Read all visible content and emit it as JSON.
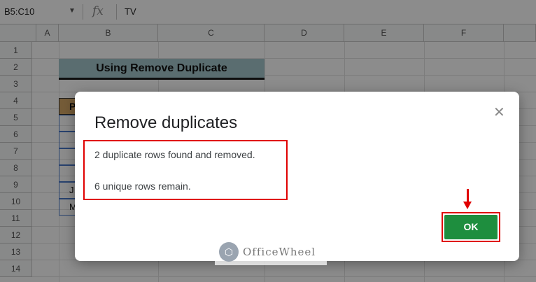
{
  "formula_bar": {
    "name_box": "B5:C10",
    "fx_label": "fx",
    "value": "TV"
  },
  "columns": [
    "A",
    "B",
    "C",
    "D",
    "E",
    "F"
  ],
  "rows": [
    "1",
    "2",
    "3",
    "4",
    "5",
    "6",
    "7",
    "8",
    "9",
    "10",
    "11",
    "12",
    "13",
    "14"
  ],
  "sheet": {
    "title": "Using Remove Duplicate",
    "header_partial": "P",
    "partial_cells": [
      "",
      "",
      "",
      "",
      "J",
      "M"
    ]
  },
  "dialog": {
    "title": "Remove duplicates",
    "close": "✕",
    "message_1": "2 duplicate rows found and removed.",
    "message_2": "6 unique rows remain.",
    "ok_label": "OK"
  },
  "watermark": {
    "logo": "⬡",
    "text": "OfficeWheel"
  },
  "colors": {
    "ok_button": "#1e8e3e",
    "highlight": "#e00000",
    "title_fill": "#a5c6cc",
    "header_fill": "#d6a866"
  }
}
